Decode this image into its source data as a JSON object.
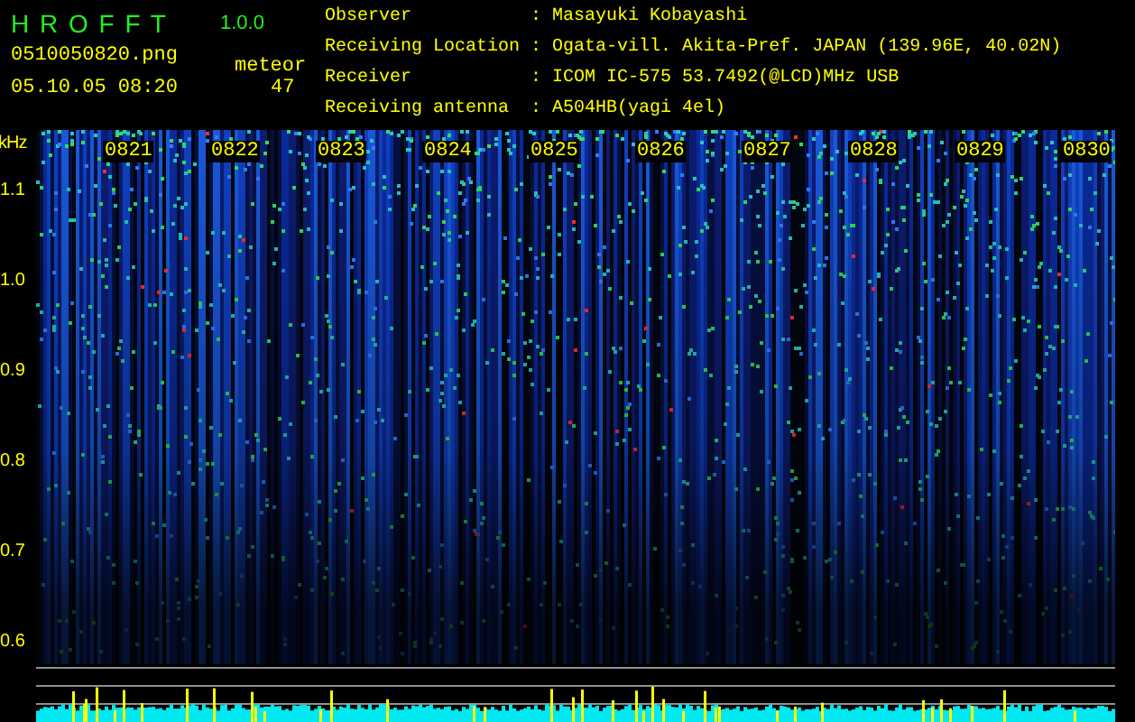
{
  "app": {
    "title": "H R O F F T",
    "version": "1.0.0"
  },
  "capture": {
    "filename": "0510050820.png",
    "datetime": "05.10.05 08:20",
    "count_label": "meteor",
    "count": "47"
  },
  "info": [
    {
      "label": "Observer",
      "separator": ":",
      "value": "Masayuki Kobayashi"
    },
    {
      "label": "Receiving Location",
      "separator": ":",
      "value": "Ogata-vill. Akita-Pref. JAPAN (139.96E, 40.02N)"
    },
    {
      "label": "Receiver",
      "separator": ":",
      "value": "ICOM IC-575 53.7492(@LCD)MHz USB"
    },
    {
      "label": "Receiving antenna",
      "separator": ":",
      "value": "A504HB(yagi 4el)"
    }
  ],
  "frequency_axis": {
    "unit": "kHz",
    "ticks": [
      "1.1",
      "1.0",
      "0.9",
      "0.8",
      "0.7",
      "0.6"
    ]
  },
  "time_labels": [
    "0821",
    "0822",
    "0823",
    "0824",
    "0825",
    "0826",
    "0827",
    "0828",
    "0829",
    "0830"
  ]
}
